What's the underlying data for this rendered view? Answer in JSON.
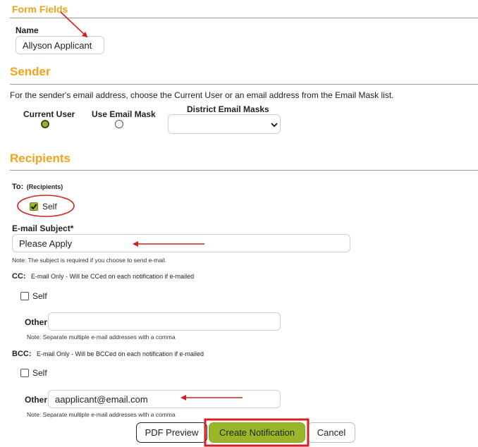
{
  "form_fields": {
    "title": "Form Fields",
    "name_label": "Name",
    "name_value": "Allyson Applicant"
  },
  "sender": {
    "title": "Sender",
    "description": "For the sender's email address, choose the Current User or an email address from the Email Mask list.",
    "current_user_label": "Current User",
    "use_email_mask_label": "Use Email Mask",
    "district_email_masks_label": "District Email Masks",
    "selected": "current_user",
    "mask_selected": ""
  },
  "recipients": {
    "title": "Recipients",
    "to_label": "To:",
    "to_sub": "(Recipients)",
    "to_self_label": "Self",
    "to_self_checked": true,
    "subject_label": "E-mail Subject*",
    "subject_value": "Please Apply",
    "subject_note": "Note: The subject is required if you choose to send e-mail.",
    "cc_label": "CC:",
    "cc_note": "E-mail Only - Will be CCed on each notification if e-mailed",
    "cc_self_label": "Self",
    "cc_other_label": "Other",
    "cc_other_value": "",
    "cc_other_note": "Note: Separate multiple e-mail addresses with a comma",
    "bcc_label": "BCC:",
    "bcc_note": "E-mail Only - Will be BCCed on each notification if e-mailed",
    "bcc_self_label": "Self",
    "bcc_other_label": "Other",
    "bcc_other_value": "aapplicant@email.com",
    "bcc_other_note": "Note: Separate multiple e-mail addresses with a comma"
  },
  "buttons": {
    "pdf_preview": "PDF Preview",
    "create_notification": "Create Notification",
    "cancel": "Cancel"
  },
  "colors": {
    "section_title": "#f5a21b",
    "accent_green": "#9ab628",
    "annotation_red": "#d42020"
  }
}
